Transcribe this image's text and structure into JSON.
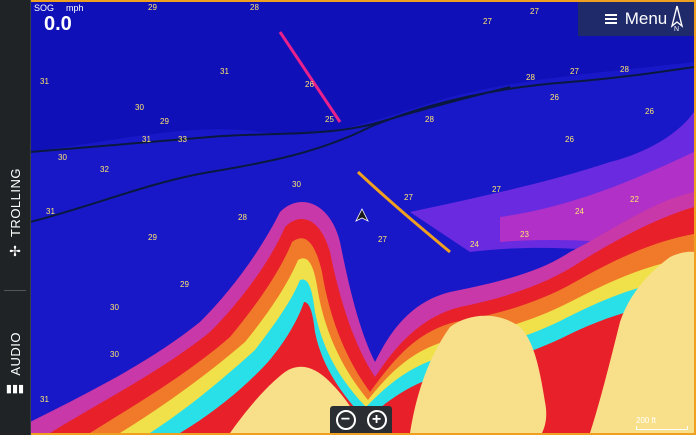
{
  "sidebar": {
    "trolling_label": "TROLLING",
    "audio_label": "AUDIO",
    "trolling_icon": "propeller-icon",
    "audio_icon": "equalizer-icon"
  },
  "sog": {
    "label": "SOG",
    "unit": "mph",
    "value": "0.0"
  },
  "menu": {
    "label": "Menu",
    "icon": "hamburger-icon"
  },
  "compass": {
    "label": "N"
  },
  "scale": {
    "label": "200 ft"
  },
  "zoom": {
    "minus": "−",
    "plus": "+"
  },
  "depth_labels_deep": [
    "29",
    "28",
    "27",
    "26",
    "25",
    "24",
    "30",
    "31",
    "32",
    "33",
    "23",
    "22"
  ],
  "colors": {
    "deep": "#1616d6",
    "mid_deep": "#2a2ae8",
    "purple": "#9a2ad8",
    "magenta": "#e83a9a",
    "red": "#e8202a",
    "orange": "#f07a2a",
    "yellow": "#f0e04a",
    "cyan": "#2ae0e8",
    "land": "#f8e08a",
    "accent": "#f0a020"
  }
}
